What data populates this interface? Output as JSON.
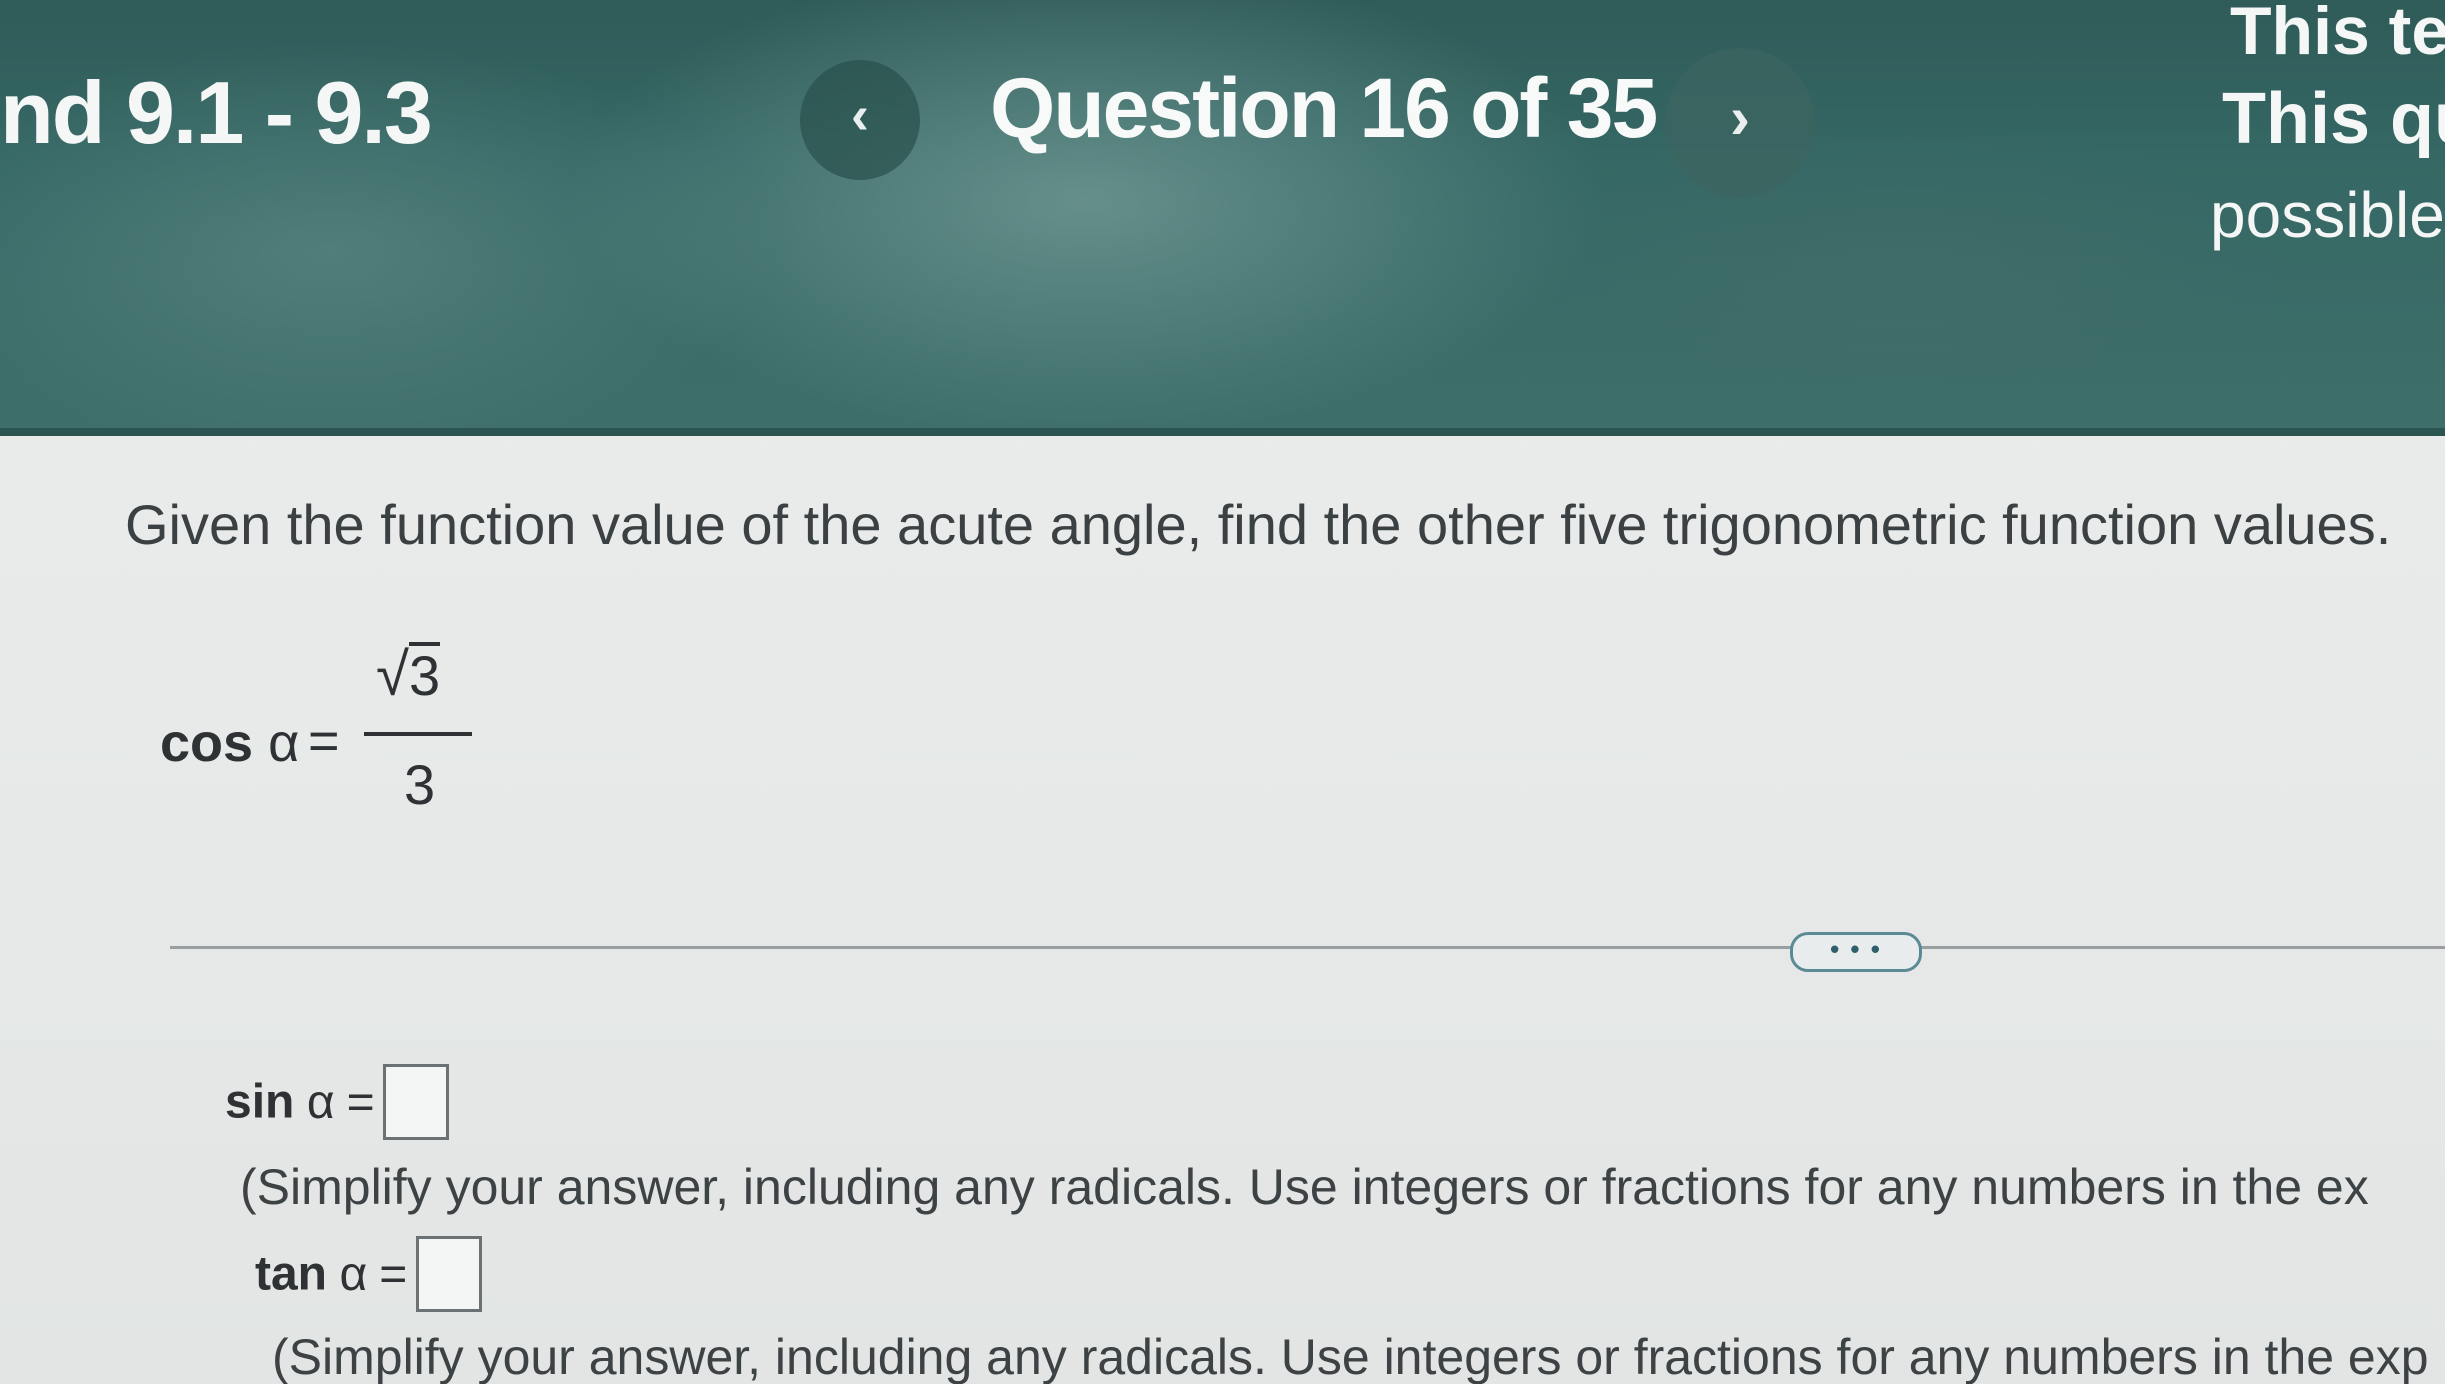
{
  "header": {
    "course_title": "nd 9.1 - 9.3",
    "question_counter": "Question 16 of 35",
    "prev_glyph": "‹",
    "next_glyph": "›",
    "side_note": [
      "This te",
      "This qu",
      "possible"
    ]
  },
  "question": {
    "instruction": "Given the function value of the acute angle, find the other five trigonometric function values.",
    "given": {
      "function": "cos",
      "variable": "α",
      "equals": "=",
      "numerator_radicand": "3",
      "radical_symbol": "√",
      "denominator": "3"
    },
    "more_button_label": "• • •"
  },
  "answers": [
    {
      "function": "sin",
      "variable": "α",
      "equals": "=",
      "value": "",
      "hint": "(Simplify your answer, including any radicals. Use integers or fractions for any numbers in the ex"
    },
    {
      "function": "tan",
      "variable": "α",
      "equals": "=",
      "value": "",
      "hint": "(Simplify your answer, including any radicals. Use integers or fractions for any numbers in the exp"
    }
  ],
  "colors": {
    "header_bg": "#356764",
    "page_bg": "#e9eceb",
    "text": "#3b4043",
    "more_button_border": "#5a8a96"
  }
}
